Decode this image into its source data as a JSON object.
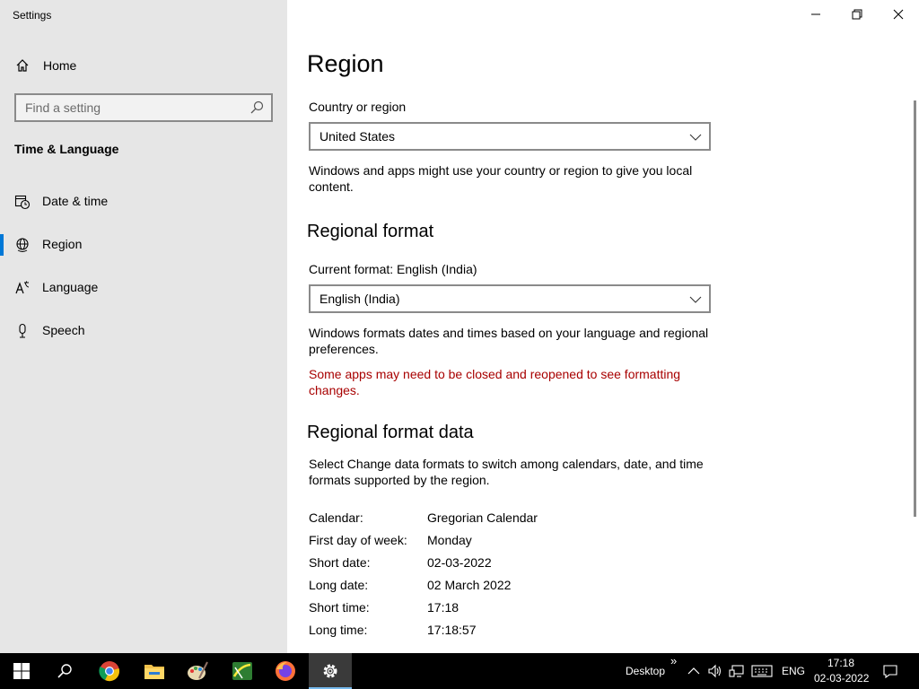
{
  "window": {
    "title": "Settings",
    "controls": {
      "minimize": "minimize-icon",
      "restore": "restore-icon",
      "close": "close-icon"
    }
  },
  "sidebar": {
    "home_label": "Home",
    "search_placeholder": "Find a setting",
    "section_title": "Time & Language",
    "items": [
      {
        "label": "Date & time",
        "icon": "calendar-clock-icon",
        "selected": false
      },
      {
        "label": "Region",
        "icon": "globe-icon",
        "selected": true
      },
      {
        "label": "Language",
        "icon": "language-icon",
        "selected": false
      },
      {
        "label": "Speech",
        "icon": "microphone-icon",
        "selected": false
      }
    ]
  },
  "main": {
    "title": "Region",
    "country": {
      "label": "Country or region",
      "value": "United States",
      "description": "Windows and apps might use your country or region to give you local content."
    },
    "regional_format": {
      "heading": "Regional format",
      "current_label": "Current format: English (India)",
      "value": "English (India)",
      "description": "Windows formats dates and times based on your language and regional preferences.",
      "warning": "Some apps may need to be closed and reopened to see formatting changes."
    },
    "format_data": {
      "heading": "Regional format data",
      "description": "Select Change data formats to switch among calendars, date, and time formats supported by the region.",
      "rows": [
        {
          "key": "Calendar:",
          "value": "Gregorian Calendar"
        },
        {
          "key": "First day of week:",
          "value": "Monday"
        },
        {
          "key": "Short date:",
          "value": "02-03-2022"
        },
        {
          "key": "Long date:",
          "value": "02 March 2022"
        },
        {
          "key": "Short time:",
          "value": "17:18"
        },
        {
          "key": "Long time:",
          "value": "17:18:57"
        }
      ]
    }
  },
  "taskbar": {
    "desktop_label": "Desktop",
    "overflow_glyph": "»",
    "lang": "ENG",
    "time": "17:18",
    "date": "02-03-2022",
    "accent": "#0078d7",
    "apps": [
      "start-icon",
      "search-icon",
      "chrome-icon",
      "file-explorer-icon",
      "paint-icon",
      "maps-icon",
      "firefox-icon",
      "settings-icon"
    ]
  }
}
